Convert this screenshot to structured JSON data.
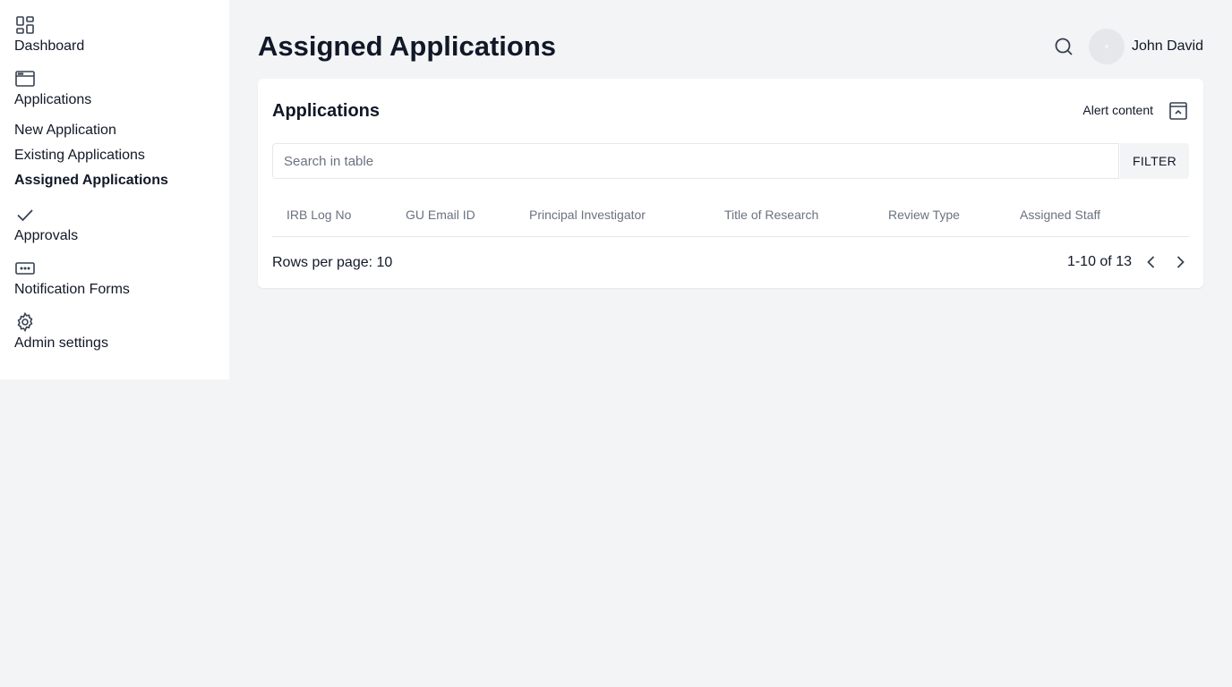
{
  "page": {
    "title": "Assigned Applications"
  },
  "header": {
    "user_name": "John David"
  },
  "sidebar": {
    "dashboard": {
      "label": "Dashboard",
      "icon": "dashboard-icon"
    },
    "applications": {
      "label": "Applications",
      "icon": "window-icon",
      "items": [
        {
          "label": "New Application"
        },
        {
          "label": "Existing Applications"
        },
        {
          "label": "Assigned Applications"
        }
      ]
    },
    "approvals": {
      "label": "Approvals",
      "icon": "check-icon"
    },
    "notification_forms": {
      "label": "Notification Forms",
      "icon": "form-icon"
    },
    "admin_settings": {
      "label": "Admin settings",
      "icon": "gear-icon"
    }
  },
  "card": {
    "title": "Applications",
    "alert_link": "Alert content",
    "search_placeholder": "Search in table",
    "filter_label": "FILTER",
    "columns": [
      "IRB Log No",
      "GU Email ID",
      "Principal Investigator",
      "Title of Research",
      "Review Type",
      "Assigned Staff"
    ],
    "rows_per_page": "Rows per page: 10",
    "page_range": "1-10 of 13"
  }
}
